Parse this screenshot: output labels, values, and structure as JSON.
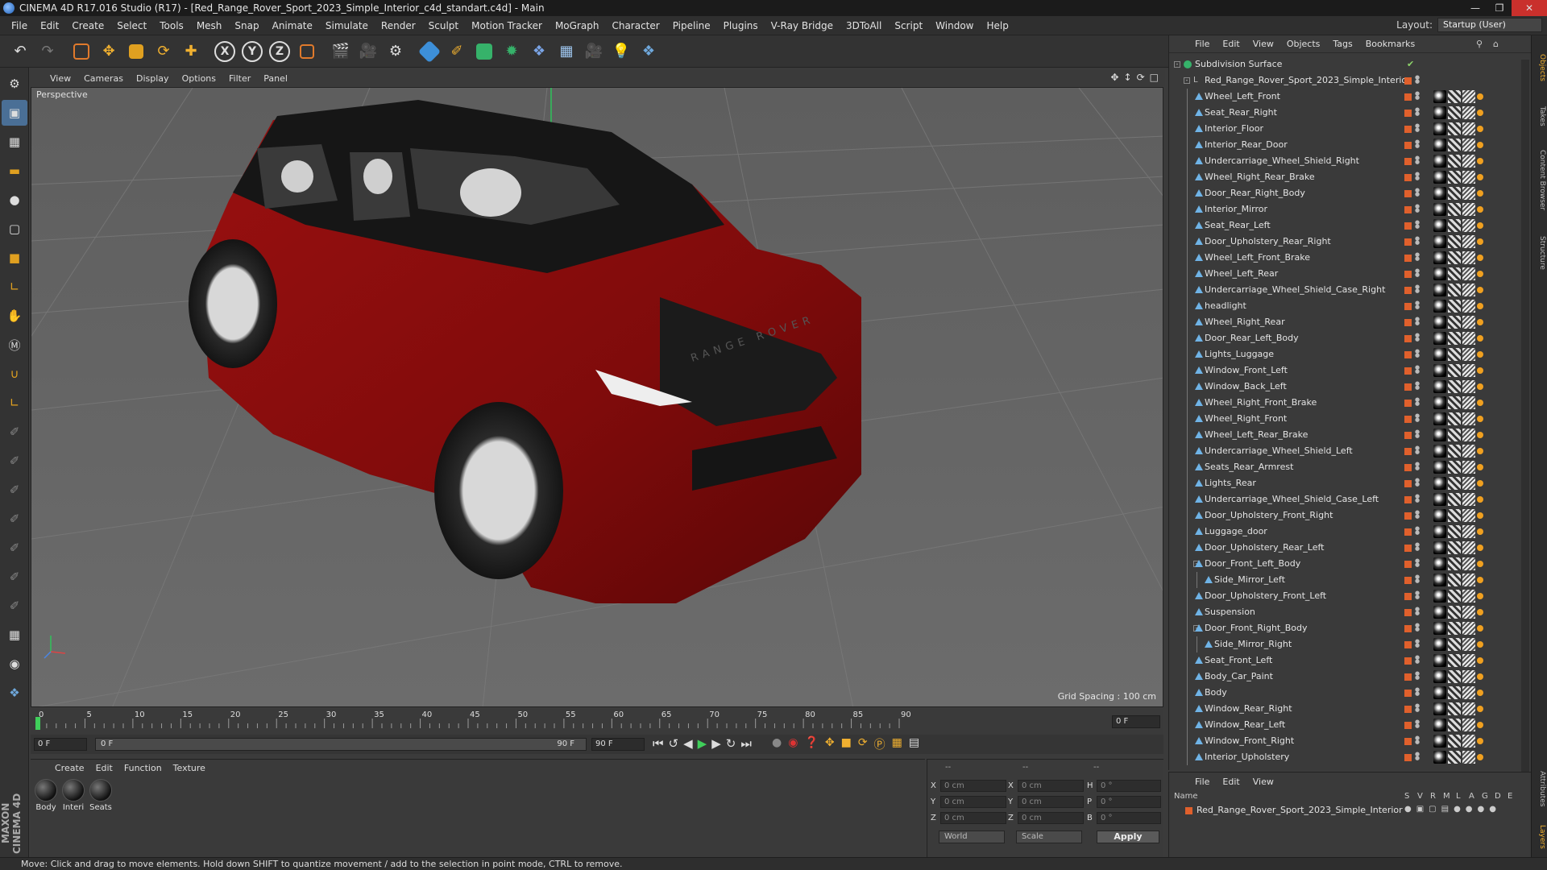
{
  "window": {
    "title": "CINEMA 4D R17.016 Studio (R17) - [Red_Range_Rover_Sport_2023_Simple_Interior_c4d_standart.c4d] - Main"
  },
  "menu": [
    "File",
    "Edit",
    "Create",
    "Select",
    "Tools",
    "Mesh",
    "Snap",
    "Animate",
    "Simulate",
    "Render",
    "Sculpt",
    "Motion Tracker",
    "MoGraph",
    "Character",
    "Pipeline",
    "Plugins",
    "V-Ray Bridge",
    "3DToAll",
    "Script",
    "Window",
    "Help"
  ],
  "layout": {
    "label": "Layout:",
    "value": "Startup (User)"
  },
  "toolbar_axes": [
    "X",
    "Y",
    "Z"
  ],
  "viewport": {
    "menu": [
      "View",
      "Cameras",
      "Display",
      "Options",
      "Filter",
      "Panel"
    ],
    "label": "Perspective",
    "grid_spacing": "Grid Spacing : 100 cm",
    "hood_text": "RANGE ROVER"
  },
  "timeline": {
    "ticks": [
      "0",
      "5",
      "10",
      "15",
      "20",
      "25",
      "30",
      "35",
      "40",
      "45",
      "50",
      "55",
      "60",
      "65",
      "70",
      "75",
      "80",
      "85",
      "90"
    ],
    "current_frame": "0 F",
    "start_field": "0 F",
    "range_start": "0 F",
    "range_end": "90 F",
    "end_field": "90 F"
  },
  "materials": {
    "menu": [
      "Create",
      "Edit",
      "Function",
      "Texture"
    ],
    "items": [
      {
        "label": "Body"
      },
      {
        "label": "Interi"
      },
      {
        "label": "Seats"
      }
    ]
  },
  "coords": {
    "header": [
      "--",
      "--",
      "--"
    ],
    "rows": [
      {
        "a": "X",
        "av": "0 cm",
        "b": "X",
        "bv": "0 cm",
        "c": "H",
        "cv": "0 °"
      },
      {
        "a": "Y",
        "av": "0 cm",
        "b": "Y",
        "bv": "0 cm",
        "c": "P",
        "cv": "0 °"
      },
      {
        "a": "Z",
        "av": "0 cm",
        "b": "Z",
        "bv": "0 cm",
        "c": "B",
        "cv": "0 °"
      }
    ],
    "world": "World",
    "scale": "Scale",
    "apply": "Apply"
  },
  "objects": {
    "menu": [
      "File",
      "Edit",
      "View",
      "Objects",
      "Tags",
      "Bookmarks"
    ],
    "root": "Subdivision Surface",
    "group": "Red_Range_Rover_Sport_2023_Simple_Interior",
    "items": [
      {
        "name": "Wheel_Left_Front",
        "level": 2
      },
      {
        "name": "Seat_Rear_Right",
        "level": 2
      },
      {
        "name": "Interior_Floor",
        "level": 2
      },
      {
        "name": "Interior_Rear_Door",
        "level": 2
      },
      {
        "name": "Undercarriage_Wheel_Shield_Right",
        "level": 2
      },
      {
        "name": "Wheel_Right_Rear_Brake",
        "level": 2
      },
      {
        "name": "Door_Rear_Right_Body",
        "level": 2
      },
      {
        "name": "Interior_Mirror",
        "level": 2
      },
      {
        "name": "Seat_Rear_Left",
        "level": 2
      },
      {
        "name": "Door_Upholstery_Rear_Right",
        "level": 2
      },
      {
        "name": "Wheel_Left_Front_Brake",
        "level": 2
      },
      {
        "name": "Wheel_Left_Rear",
        "level": 2
      },
      {
        "name": "Undercarriage_Wheel_Shield_Case_Right",
        "level": 2
      },
      {
        "name": "headlight",
        "level": 2
      },
      {
        "name": "Wheel_Right_Rear",
        "level": 2
      },
      {
        "name": "Door_Rear_Left_Body",
        "level": 2
      },
      {
        "name": "Lights_Luggage",
        "level": 2
      },
      {
        "name": "Window_Front_Left",
        "level": 2
      },
      {
        "name": "Window_Back_Left",
        "level": 2
      },
      {
        "name": "Wheel_Right_Front_Brake",
        "level": 2
      },
      {
        "name": "Wheel_Right_Front",
        "level": 2
      },
      {
        "name": "Wheel_Left_Rear_Brake",
        "level": 2
      },
      {
        "name": "Undercarriage_Wheel_Shield_Left",
        "level": 2
      },
      {
        "name": "Seats_Rear_Armrest",
        "level": 2
      },
      {
        "name": "Lights_Rear",
        "level": 2
      },
      {
        "name": "Undercarriage_Wheel_Shield_Case_Left",
        "level": 2
      },
      {
        "name": "Door_Upholstery_Front_Right",
        "level": 2
      },
      {
        "name": "Luggage_door",
        "level": 2
      },
      {
        "name": "Door_Upholstery_Rear_Left",
        "level": 2
      },
      {
        "name": "Door_Front_Left_Body",
        "level": 2,
        "expanded": true
      },
      {
        "name": "Side_Mirror_Left",
        "level": 3
      },
      {
        "name": "Door_Upholstery_Front_Left",
        "level": 2
      },
      {
        "name": "Suspension",
        "level": 2
      },
      {
        "name": "Door_Front_Right_Body",
        "level": 2,
        "expanded": true
      },
      {
        "name": "Side_Mirror_Right",
        "level": 3
      },
      {
        "name": "Seat_Front_Left",
        "level": 2
      },
      {
        "name": "Body_Car_Paint",
        "level": 2
      },
      {
        "name": "Body",
        "level": 2
      },
      {
        "name": "Window_Rear_Right",
        "level": 2
      },
      {
        "name": "Window_Rear_Left",
        "level": 2
      },
      {
        "name": "Window_Front_Right",
        "level": 2
      },
      {
        "name": "Interior_Upholstery",
        "level": 2
      }
    ]
  },
  "layers": {
    "menu": [
      "File",
      "Edit",
      "View"
    ],
    "columns": [
      "Name",
      "S",
      "V",
      "R",
      "M",
      "L",
      "A",
      "G",
      "D",
      "E"
    ],
    "row": "Red_Range_Rover_Sport_2023_Simple_Interior"
  },
  "status": "Move: Click and drag to move elements. Hold down SHIFT to quantize movement / add to the selection in point mode, CTRL to remove.",
  "right_tabs": [
    "Objects",
    "Takes",
    "Content Browser",
    "Structure",
    "Attributes",
    "Layers"
  ],
  "colors": {
    "car_red": "#8e0c0c",
    "layer_orange": "#e0602c",
    "accent_blue": "#4a6f96"
  }
}
